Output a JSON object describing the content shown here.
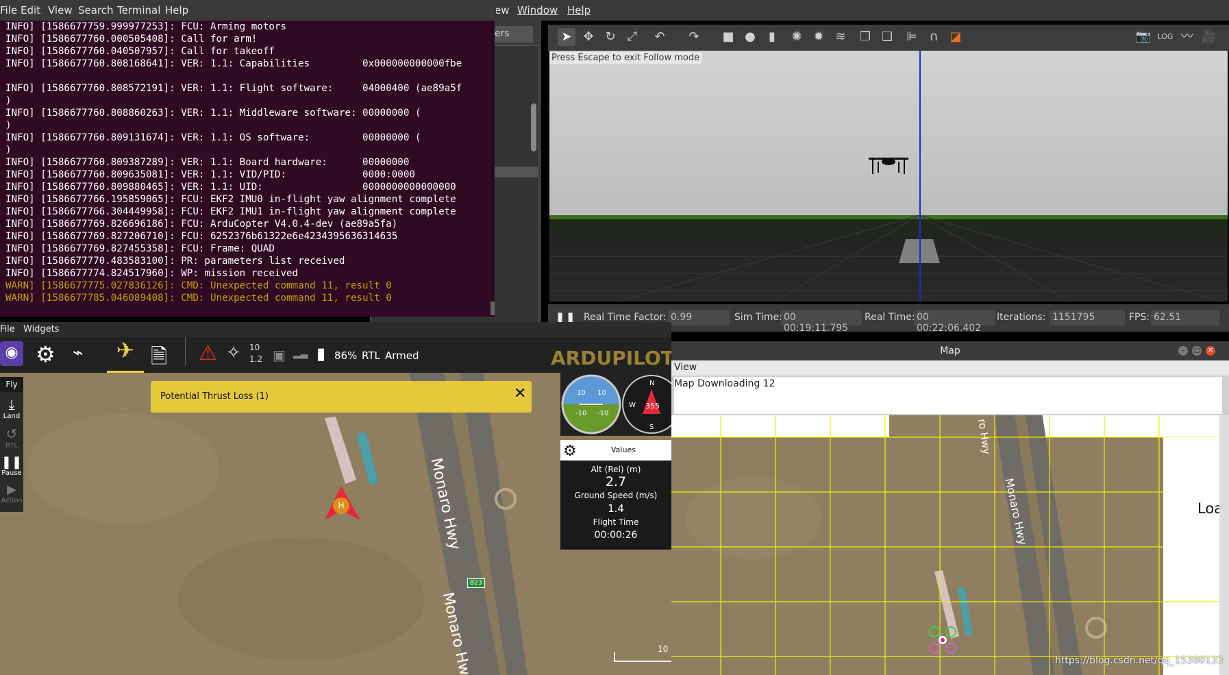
{
  "terminal": {
    "menu": [
      "File",
      "Edit",
      "View",
      "Search",
      "Terminal",
      "Help"
    ],
    "lines": [
      {
        "text": "INFO] [1586677759.999977253]: FCU: Arming motors",
        "level": "info"
      },
      {
        "text": "INFO] [1586677760.000505408]: Call for arm!",
        "level": "info"
      },
      {
        "text": "INFO] [1586677760.040507957]: Call for takeoff",
        "level": "info"
      },
      {
        "text": "INFO] [1586677760.808168641]: VER: 1.1: Capabilities         0x000000000000fbe",
        "level": "info"
      },
      {
        "text": "",
        "level": "info"
      },
      {
        "text": "INFO] [1586677760.808572191]: VER: 1.1: Flight software:     04000400 (ae89a5f",
        "level": "info"
      },
      {
        "text": ")",
        "level": "info"
      },
      {
        "text": "INFO] [1586677760.808860263]: VER: 1.1: Middleware software: 00000000 (",
        "level": "info"
      },
      {
        "text": ")",
        "level": "info"
      },
      {
        "text": "INFO] [1586677760.809131674]: VER: 1.1: OS software:         00000000 (",
        "level": "info"
      },
      {
        "text": ")",
        "level": "info"
      },
      {
        "text": "INFO] [1586677760.809387289]: VER: 1.1: Board hardware:      00000000",
        "level": "info"
      },
      {
        "text": "INFO] [1586677760.809635081]: VER: 1.1: VID/PID:             0000:0000",
        "level": "info"
      },
      {
        "text": "INFO] [1586677760.809880465]: VER: 1.1: UID:                 0000000000000000",
        "level": "info"
      },
      {
        "text": "INFO] [1586677766.195859065]: FCU: EKF2 IMU0 in-flight yaw alignment complete",
        "level": "info"
      },
      {
        "text": "INFO] [1586677766.304449958]: FCU: EKF2 IMU1 in-flight yaw alignment complete",
        "level": "info"
      },
      {
        "text": "INFO] [1586677769.826696186]: FCU: ArduCopter V4.0.4-dev (ae89a5fa)",
        "level": "info"
      },
      {
        "text": "INFO] [1586677769.827206710]: FCU: 6252376b61322e6e4234395636314635",
        "level": "info"
      },
      {
        "text": "INFO] [1586677769.827455358]: FCU: Frame: QUAD",
        "level": "info"
      },
      {
        "text": "INFO] [1586677770.483583100]: PR: parameters list received",
        "level": "info"
      },
      {
        "text": "INFO] [1586677774.824517960]: WP: mission received",
        "level": "info"
      },
      {
        "text": "WARN] [1586677775.027836126]: CMD: Unexpected command 11, result 0",
        "level": "warn"
      },
      {
        "text": "WARN] [1586677785.046089408]: CMD: Unexpected command 11, result 0",
        "level": "warn"
      }
    ]
  },
  "gazebo": {
    "menu": [
      "ew",
      "Window",
      "Help"
    ],
    "side_tab": "ers",
    "escape_hint": "Press Escape to exit Follow mode",
    "status": {
      "rtf_label": "Real Time Factor:",
      "rtf": "0.99",
      "sim_label": "Sim Time:",
      "sim": "00 00:19:11.795",
      "real_label": "Real Time:",
      "real": "00 00:22:06.402",
      "iter_label": "Iterations:",
      "iter": "1151795",
      "fps_label": "FPS:",
      "fps": "62.51"
    }
  },
  "qgc": {
    "menu": [
      "File",
      "Widgets"
    ],
    "toolbar": {
      "gps_count": "10",
      "hdop": "1.2",
      "battery": "86%",
      "mode": "RTL",
      "armed": "Armed"
    },
    "fly_label": "Fly",
    "fly_actions": [
      "Land",
      "RTL",
      "Pause",
      "Action"
    ],
    "alert": "Potential Thrust Loss (1)",
    "compass_heading": "355",
    "attitude_labels": [
      "10",
      "10",
      "-10",
      "-10"
    ],
    "compass_labels": [
      "N",
      "W",
      "S"
    ],
    "values_title": "Values",
    "values": [
      {
        "label": "Alt (Rel) (m)",
        "value": "2.7"
      },
      {
        "label": "Ground Speed (m/s)",
        "value": "1.4"
      },
      {
        "label": "Flight Time",
        "value": "00:00:26"
      }
    ],
    "road_label": "Monaro Hwy",
    "road_label2": "Monaro Hw",
    "route_badge": "B23",
    "home_label": "H",
    "scale_text": "10"
  },
  "map_window": {
    "title": "Map",
    "menu": "View",
    "status": "Map Downloading 12",
    "road_label": "Monaro Hwy",
    "road_label2": "ro Hwy",
    "loading_text": "Loa"
  },
  "watermark": "https://blog.csdn.net/qq_15390133",
  "colors": {
    "terminal_bg": "#300a24",
    "warn": "#c4a000",
    "alert_bg": "#e5c93b",
    "grid": "#f0f000"
  }
}
